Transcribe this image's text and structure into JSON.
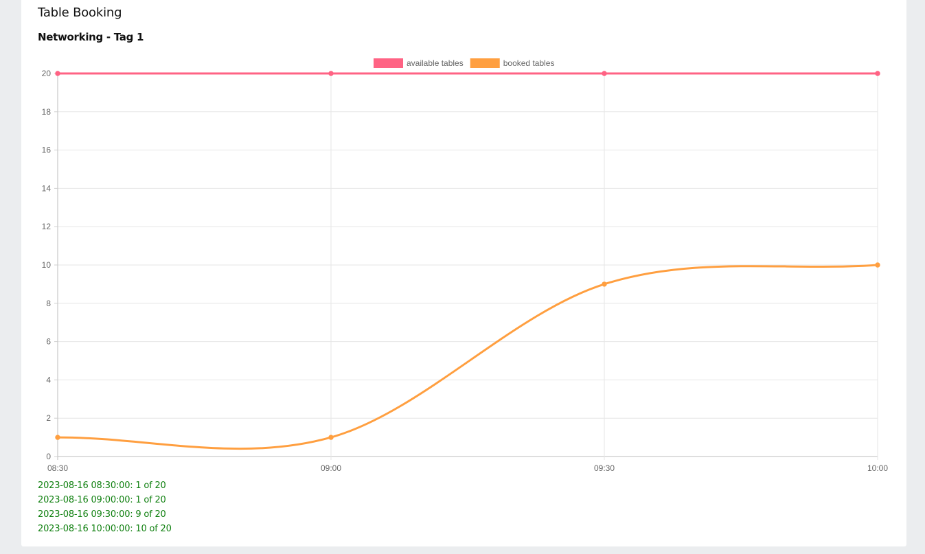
{
  "header": {
    "title": "Table Booking",
    "subtitle": "Networking - Tag 1"
  },
  "chart_data": {
    "type": "line",
    "categories": [
      "08:30",
      "09:00",
      "09:30",
      "10:00"
    ],
    "series": [
      {
        "name": "available tables",
        "values": [
          20,
          20,
          20,
          20
        ],
        "color": "#ff6384"
      },
      {
        "name": "booked tables",
        "values": [
          1,
          1,
          9,
          10
        ],
        "color": "#ff9f40"
      }
    ],
    "ylim": [
      0,
      20
    ],
    "yticks": [
      0,
      2,
      4,
      6,
      8,
      10,
      12,
      14,
      16,
      18,
      20
    ],
    "legend": "top",
    "grid": true,
    "curve": "smooth"
  },
  "summary": {
    "lines": [
      "2023-08-16 08:30:00: 1 of 20",
      "2023-08-16 09:00:00: 1 of 20",
      "2023-08-16 09:30:00: 9 of 20",
      "2023-08-16 10:00:00: 10 of 20"
    ]
  }
}
